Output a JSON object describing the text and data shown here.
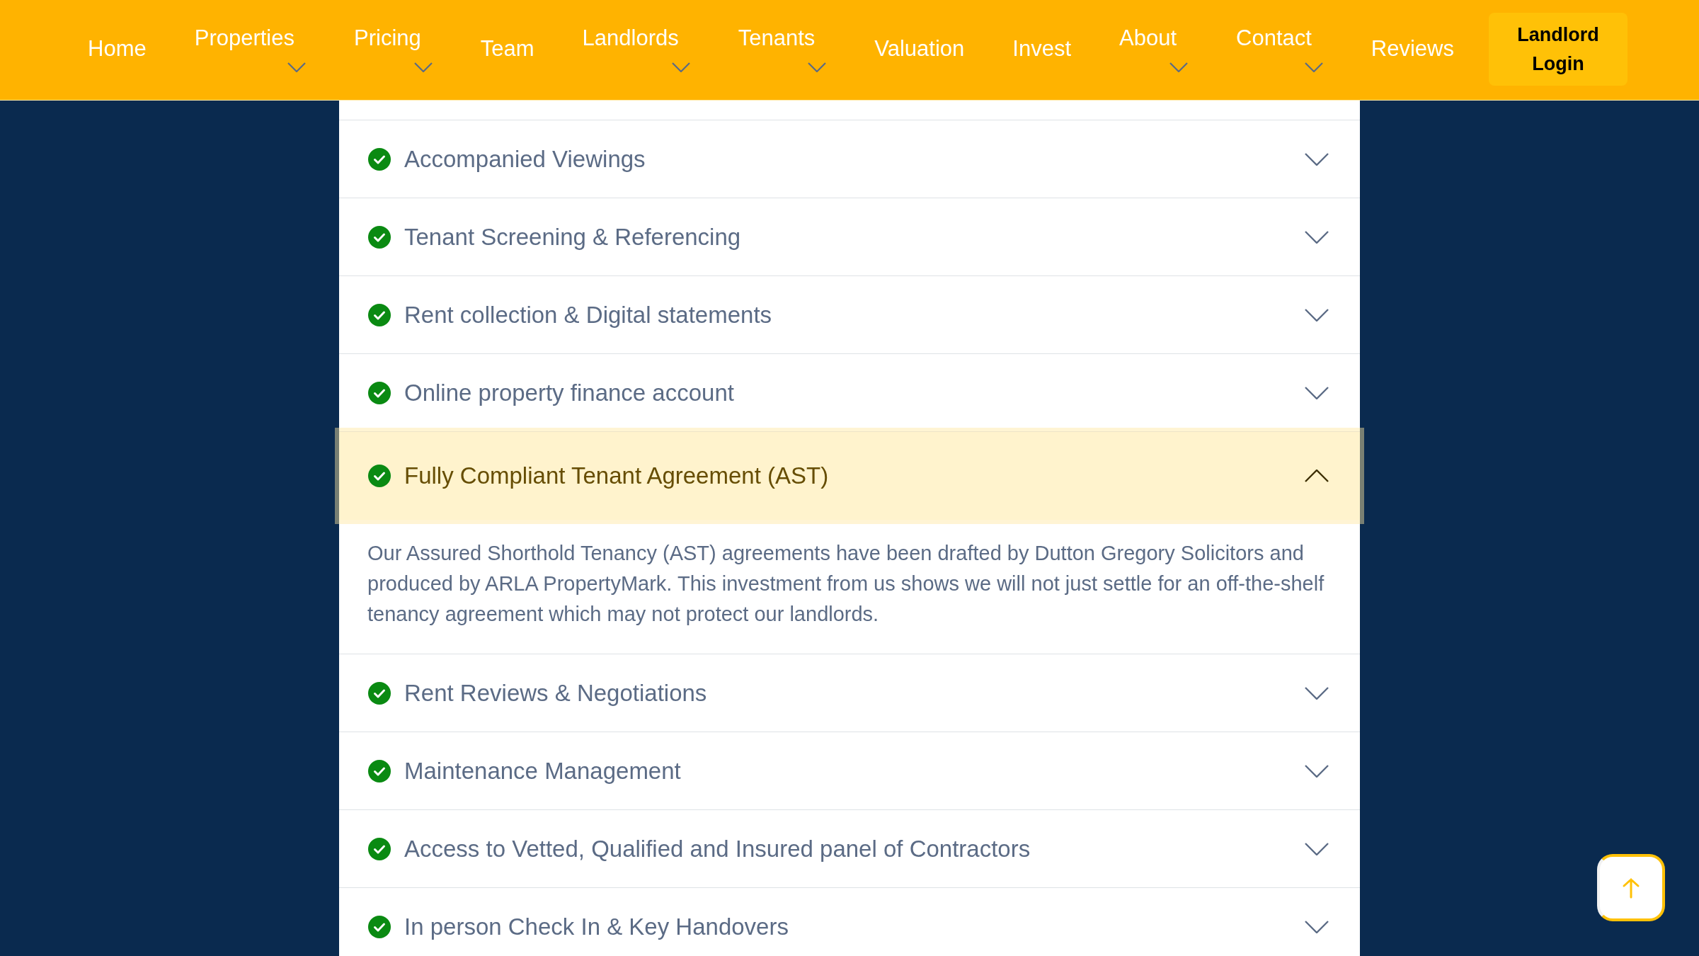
{
  "nav": {
    "items": [
      {
        "label": "Home",
        "dropdown": false
      },
      {
        "label": "Properties",
        "dropdown": true
      },
      {
        "label": "Pricing",
        "dropdown": true
      },
      {
        "label": "Team",
        "dropdown": false
      },
      {
        "label": "Landlords",
        "dropdown": true
      },
      {
        "label": "Tenants",
        "dropdown": true
      },
      {
        "label": "Valuation",
        "dropdown": false
      },
      {
        "label": "Invest",
        "dropdown": false
      },
      {
        "label": "About",
        "dropdown": true
      },
      {
        "label": "Contact",
        "dropdown": true
      },
      {
        "label": "Reviews",
        "dropdown": false
      }
    ],
    "login_button": {
      "label": "Landlord Login"
    }
  },
  "accordion": {
    "items": [
      {
        "title": "Accompanied Viewings",
        "expanded": false
      },
      {
        "title": "Tenant Screening & Referencing",
        "expanded": false
      },
      {
        "title": "Rent collection & Digital statements",
        "expanded": false
      },
      {
        "title": "Online property finance account",
        "expanded": false
      },
      {
        "title": "Fully Compliant Tenant Agreement (AST)",
        "expanded": true,
        "body": "Our Assured Shorthold Tenancy (AST) agreements have been drafted by Dutton Gregory Solicitors and produced by ARLA PropertyMark. This investment from us shows we will not just settle for an off-the-shelf tenancy agreement which may not protect our landlords."
      },
      {
        "title": "Rent Reviews & Negotiations",
        "expanded": false
      },
      {
        "title": "Maintenance Management",
        "expanded": false
      },
      {
        "title": "Access to Vetted, Qualified and Insured panel of Contractors",
        "expanded": false
      },
      {
        "title": "In person Check In & Key Handovers",
        "expanded": false
      }
    ]
  }
}
